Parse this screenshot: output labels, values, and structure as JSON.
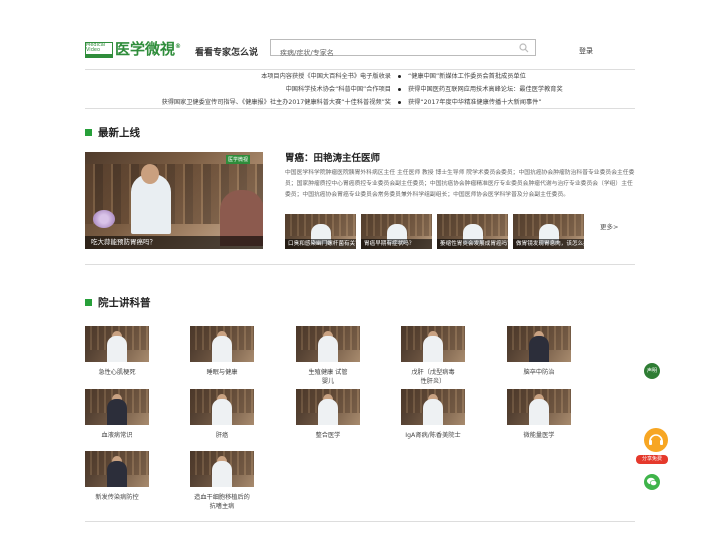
{
  "header": {
    "logo_small": "Medical Video",
    "logo_text": "医学微視",
    "logo_mark": "®",
    "slogan": "看看专家怎么说",
    "search_placeholder": "疾病/症状/专家名",
    "login": "登录"
  },
  "notices": {
    "rows": [
      {
        "left": "本项目内容获授《中国大百科全书》电子版收录",
        "right": "“健康中国”新媒体工作委员会首批成员单位"
      },
      {
        "left": "中国科学技术协会“科普中国”合作项目",
        "right": "获得中国医药互联网应用技术高峰论坛：最佳医学教育奖"
      },
      {
        "left": "获得国家卫健委宣传司指导、《健康报》社主办2017健康科普大赛“十佳科普视频”奖",
        "right": "获得“2017年度中华精准健康传播十大新闻事件”"
      }
    ]
  },
  "latest": {
    "title": "最新上线",
    "feature_caption": "吃大蒜能预防胃癌吗？",
    "feature_watermark": "医学微视",
    "doctor_name": "胃癌：田艳涛主任医师",
    "doctor_desc": "中国医学科学院肿瘤医院胰胃外科病区主任 主任医师 教授 博士生导师 院学术委员会委员；中国抗癌协会肿瘤防治科普专业委员会主任委员；国家肿瘤质控中心胃癌质控专业委员会副主任委员；中国抗癌协会肿瘤精准医疗专业委员会肿瘤代谢与治疗专业委员会（学组）主任委员；中国抗癌协会胃癌专业委员会常务委员兼外科学组副组长；中国医师协会医学科学普及分会副主任委员。",
    "thumbs": [
      "口臭和感染幽门螺杆菌有关？",
      "胃癌早期有症状吗？",
      "萎缩性胃炎会发展成胃癌吗？",
      "做胃镜发现胃息肉，该怎么办？"
    ],
    "more": "更多>"
  },
  "academician": {
    "title": "院士讲科普",
    "videos": [
      {
        "title": "急性心肌梗死"
      },
      {
        "title": "睡眠与健康"
      },
      {
        "title": "生殖健康 试管婴儿"
      },
      {
        "title": "戊肝（戊型病毒性肝炎）"
      },
      {
        "title": "脑卒中防治"
      },
      {
        "title": "血液病常识"
      },
      {
        "title": "肝癌"
      },
      {
        "title": "整合医学"
      },
      {
        "title": "IgA肾病/陈香美院士"
      },
      {
        "title": "微能量医学"
      },
      {
        "title": "新发传染病防控"
      },
      {
        "title": "造血干细胞移植后的抗嗜主病"
      }
    ]
  },
  "floats": {
    "top_label": "声明",
    "service_label": "分享免费"
  },
  "colors": {
    "brand_green": "#2f8d3b",
    "section_green": "#27a03a",
    "orange": "#f7a623",
    "red": "#e5392c"
  }
}
